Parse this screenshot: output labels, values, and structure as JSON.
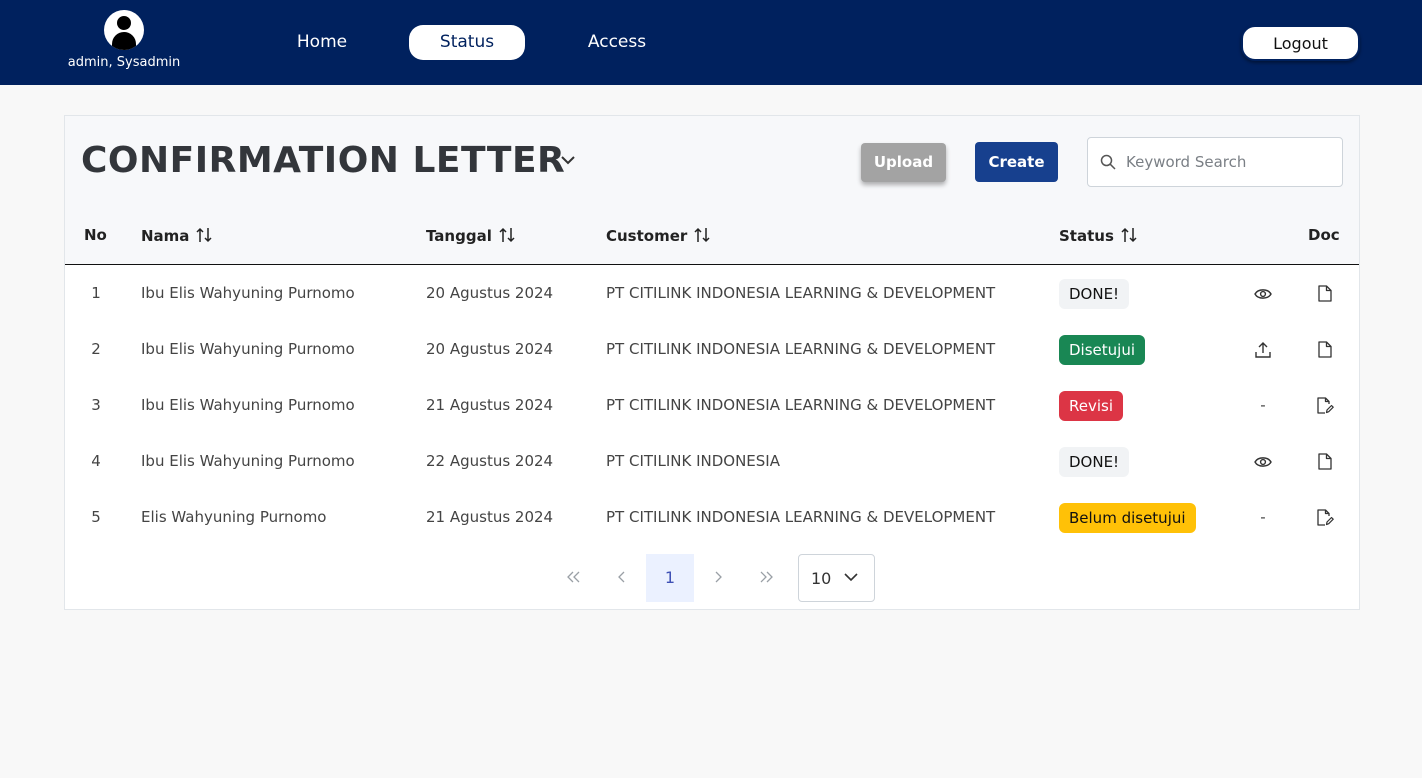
{
  "header": {
    "user_name": "admin, Sysadmin",
    "nav": {
      "home": "Home",
      "status": "Status",
      "access": "Access"
    },
    "logout_label": "Logout"
  },
  "page": {
    "title": "CONFIRMATION LETTER",
    "upload_label": "Upload",
    "create_label": "Create",
    "search_placeholder": "Keyword Search"
  },
  "table": {
    "columns": {
      "no": "No",
      "nama": "Nama",
      "tanggal": "Tanggal",
      "customer": "Customer",
      "status": "Status",
      "doc": "Doc"
    },
    "rows": [
      {
        "no": "1",
        "nama": "Ibu Elis Wahyuning Purnomo",
        "tanggal": "20 Agustus 2024",
        "customer": "PT CITILINK INDONESIA LEARNING & DEVELOPMENT",
        "status": "DONE!",
        "action": "eye-icon",
        "doc": "file-icon"
      },
      {
        "no": "2",
        "nama": "Ibu Elis Wahyuning Purnomo",
        "tanggal": "20 Agustus 2024",
        "customer": "PT CITILINK INDONESIA LEARNING & DEVELOPMENT",
        "status": "Disetujui",
        "action": "upload-icon",
        "doc": "file-icon"
      },
      {
        "no": "3",
        "nama": "Ibu Elis Wahyuning Purnomo",
        "tanggal": "21 Agustus 2024",
        "customer": "PT CITILINK INDONESIA LEARNING & DEVELOPMENT",
        "status": "Revisi",
        "action": "-",
        "doc": "file-edit-icon"
      },
      {
        "no": "4",
        "nama": "Ibu Elis Wahyuning Purnomo",
        "tanggal": "22 Agustus 2024",
        "customer": "PT CITILINK INDONESIA",
        "status": "DONE!",
        "action": "eye-icon",
        "doc": "file-icon"
      },
      {
        "no": "5",
        "nama": "Elis Wahyuning Purnomo",
        "tanggal": "21 Agustus 2024",
        "customer": "PT CITILINK INDONESIA LEARNING & DEVELOPMENT",
        "status": "Belum disetujui",
        "action": "-",
        "doc": "file-edit-icon"
      }
    ]
  },
  "pagination": {
    "current_page": "1",
    "rows_per_page": "10"
  },
  "colors": {
    "header_bg": "#00215e",
    "create_button": "#17408e",
    "upload_button": "#a3a3a3",
    "status_disetujui": "#198754",
    "status_revisi": "#dc3545",
    "status_belum": "#ffc107",
    "status_done": "#f1f3f5"
  }
}
